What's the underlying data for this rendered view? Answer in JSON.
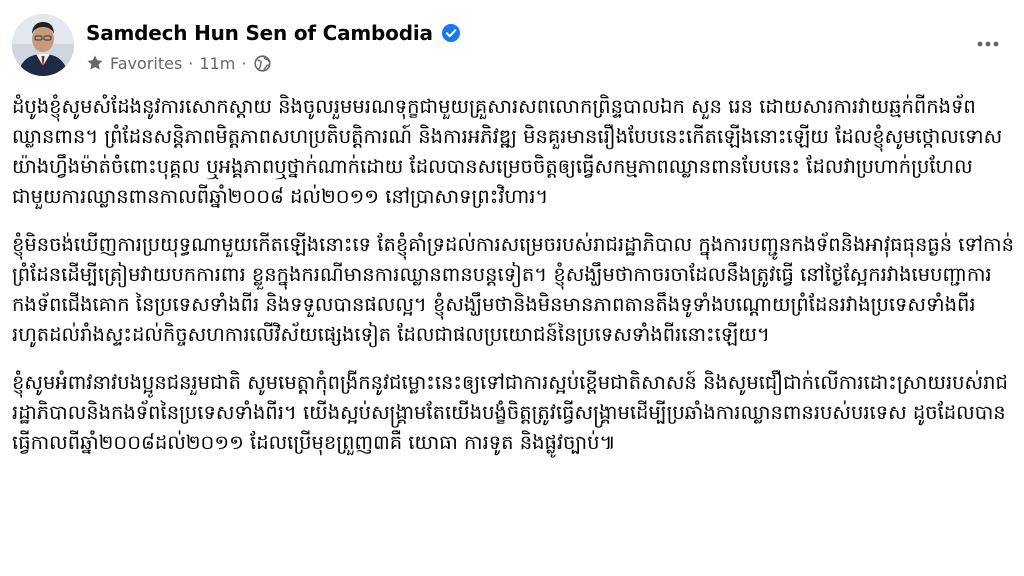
{
  "author": {
    "name": "Samdech Hun Sen of Cambodia",
    "audience": "Favorites",
    "timestamp": "11m",
    "verified_icon": "verified-badge-icon",
    "audience_icon": "star-icon",
    "privacy_icon": "globe-icon"
  },
  "menu_icon": "more-options-icon",
  "colors": {
    "verified_blue": "#1877f2",
    "meta_gray": "#65676b",
    "text": "#050505"
  },
  "post": {
    "paragraphs": [
      "ដំបូងខ្ញុំសូមសំដែងនូវការសោកស្តាយ និងចូលរួមមរណទុក្ខជាមួយគ្រួសារសពលោកព្រិន្ទបាលឯក សួន រេន ដោយសារការវាយឆ្មក់ពីកងទ័ពឈ្លានពាន។ ព្រំដែនសន្តិភាពមិត្តភាពសហប្រតិបត្តិការណ៍ និងការអភិវឌ្ឍ មិនគួរមានរឿងបែបនេះកើតឡើងនោះឡើយ ដែលខ្ញុំសូមថ្កោលទោសយ៉ាងហ្វឹងម៉ាត់ចំពោះបុគ្គល ឬអង្គភាពឬថ្នាក់ណាក់ដោយ ដែលបានសម្រេចចិត្តឲ្យធ្វើសកម្មភាពឈ្លានពានបែបនេះ ដែលវាប្រហាក់ប្រហែលជាមួយការឈ្លានពានកាលពីឆ្នាំ២០០៨ ដល់២០១១ នៅប្រាសាទព្រះវិហារ។",
      "ខ្ញុំមិនចង់ឃើញការប្រយុទ្ធណាមួយកើតឡើងនោះទេ តែខ្ញុំគាំទ្រដល់ការសម្រេចរបស់រាជរដ្ឋាភិបាល ក្នុងការបញ្ជូនកងទ័ពនិងអាវុធធុនធ្ងន់ ទៅកាន់ព្រំដែនដើម្បីត្រៀមវាយបកការពារ ខ្លួនក្នុងករណីមានការឈ្លានពានបន្តទៀត។ ខ្ញុំសង្ឃឹមថាកាចរចាដែលនឹងត្រូវធ្វើ នៅថ្ងៃស្អែករវាងមេបញ្ជាការកងទ័ពជើងគោក នៃប្រទេសទាំងពីរ និងទទួលបានផលល្អ។ ខ្ញុំសង្ឃឹមថានិងមិនមានភាពតានតឹងទូទាំងបណ្តោយព្រំដែនរវាងប្រទេសទាំងពីរ រហូតដល់រាំងស្ទះដល់កិច្ចសហការលើវិស័យផ្សេងទៀត ដែលជាផលប្រយោជន៍នៃប្រទេសទាំងពីរនោះឡើយ។",
      "ខ្ញុំសូមអំពាវនាវបងប្អូនជនរួមជាតិ សូមមេត្តាកុំពង្រីកនូវជម្លោះនេះឲ្យទៅជាការស្អប់ខ្ពើមជាតិសាសន៍ និងសូមជឿជាក់លើការដោះស្រាយរបស់រាជរដ្ឋាភិបាលនិងកងទ័ពនៃប្រទេសទាំងពីរ។ យើងស្អប់សង្រ្គាមតែយើងបង្ខំចិត្តត្រូវធ្វើសង្រ្គាមដើម្បីប្រឆាំងការឈ្លានពានរបស់បរទេស ដូចដែលបានធ្វើកាលពីឆ្នាំ២០០៨ដល់២០១១ ដែលប្រើមុខព្រួញ៣គឺ យោធា ការទូត និងផ្លូវច្បាប់៕"
    ]
  }
}
